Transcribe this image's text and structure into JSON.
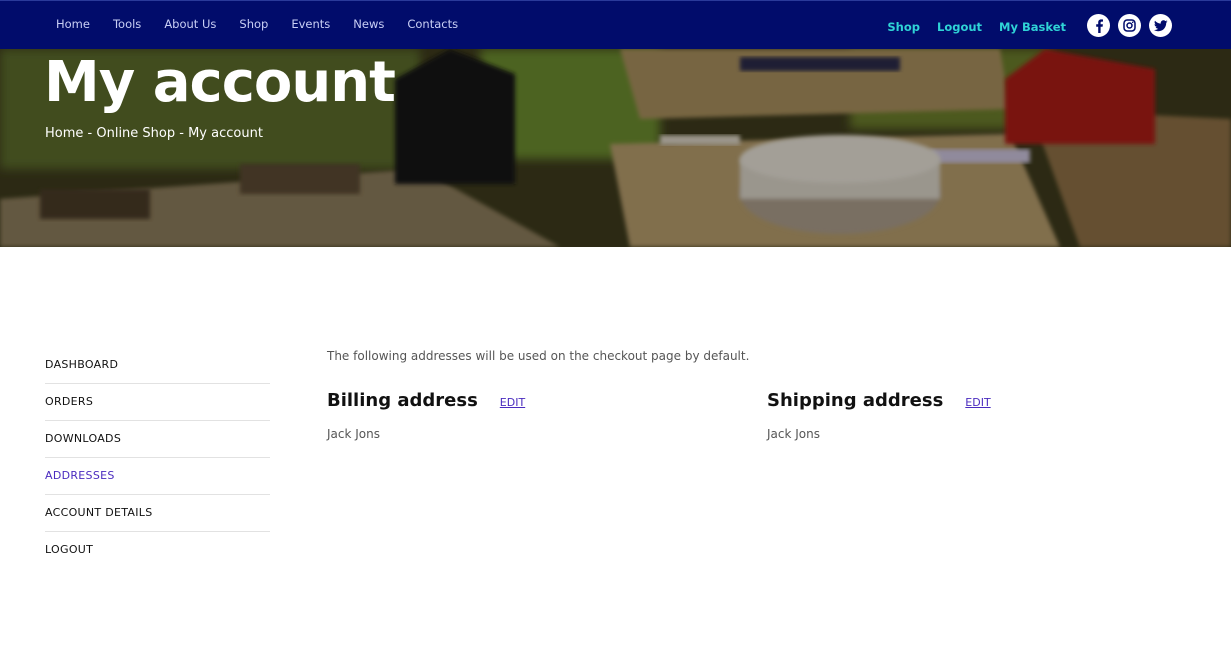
{
  "nav": {
    "left": [
      "Home",
      "Tools",
      "About Us",
      "Shop",
      "Events",
      "News",
      "Contacts"
    ],
    "right": [
      "Shop",
      "Logout",
      "My Basket"
    ],
    "social_icons": [
      "facebook-icon",
      "instagram-icon",
      "twitter-icon"
    ]
  },
  "hero": {
    "title": "My account",
    "breadcrumb": {
      "home": "Home",
      "sep1": " - ",
      "shop": "Online Shop",
      "sep2": " - ",
      "current": "My account"
    }
  },
  "account_nav": {
    "items": [
      "DASHBOARD",
      "ORDERS",
      "DOWNLOADS",
      "ADDRESSES",
      "ACCOUNT DETAILS",
      "LOGOUT"
    ],
    "active": "ADDRESSES"
  },
  "addresses": {
    "intro": "The following addresses will be used on the checkout page by default.",
    "billing": {
      "title": "Billing address",
      "edit": "EDIT",
      "name": "Jack Jons"
    },
    "shipping": {
      "title": "Shipping address",
      "edit": "EDIT",
      "name": "Jack Jons"
    }
  },
  "colors": {
    "navbar_bg": "#010c6b",
    "nav_accent": "#2fd3d6",
    "link_purple": "#4a2bbf"
  }
}
